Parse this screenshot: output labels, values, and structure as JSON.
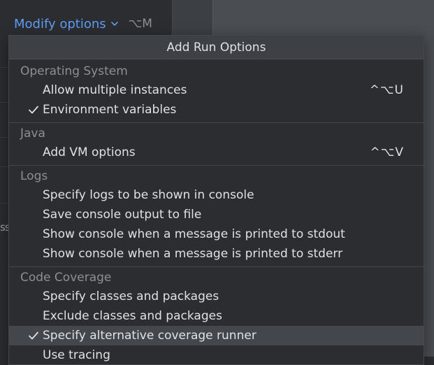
{
  "header": {
    "modify_options_label": "Modify options",
    "modify_options_shortcut": "⌥M"
  },
  "background": {
    "partial_text": "ss"
  },
  "popup": {
    "title": "Add Run Options",
    "groups": [
      {
        "title": "Operating System",
        "items": [
          {
            "label": "Allow multiple instances",
            "checked": false,
            "shortcut": "^⌥U"
          },
          {
            "label": "Environment variables",
            "checked": true,
            "shortcut": ""
          }
        ]
      },
      {
        "title": "Java",
        "items": [
          {
            "label": "Add VM options",
            "checked": false,
            "shortcut": "^⌥V"
          }
        ]
      },
      {
        "title": "Logs",
        "items": [
          {
            "label": "Specify logs to be shown in console",
            "checked": false,
            "shortcut": ""
          },
          {
            "label": "Save console output to file",
            "checked": false,
            "shortcut": ""
          },
          {
            "label": "Show console when a message is printed to stdout",
            "checked": false,
            "shortcut": ""
          },
          {
            "label": "Show console when a message is printed to stderr",
            "checked": false,
            "shortcut": ""
          }
        ]
      },
      {
        "title": "Code Coverage",
        "items": [
          {
            "label": "Specify classes and packages",
            "checked": false,
            "shortcut": ""
          },
          {
            "label": "Exclude classes and packages",
            "checked": false,
            "shortcut": ""
          },
          {
            "label": "Specify alternative coverage runner",
            "checked": true,
            "shortcut": "",
            "selected": true
          },
          {
            "label": "Use tracing",
            "checked": false,
            "shortcut": ""
          }
        ]
      }
    ]
  },
  "colors": {
    "accent_link": "#5e9cf2",
    "popup_bg": "#2b2d30",
    "header_bg": "#3d4045",
    "selected_bg": "#43464b",
    "text_primary": "#dfe1e5",
    "text_secondary": "#8c8f94"
  }
}
